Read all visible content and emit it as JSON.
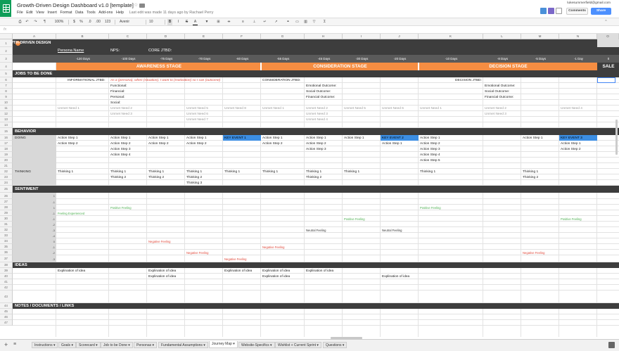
{
  "app": {
    "title": "Growth-Driven Design Dashboard v1.0 [template]",
    "last_edit": "Last edit was made 11 days ago by Rachael Perry",
    "email": "lukesummerfield@gmail.com",
    "comments_label": "Comments",
    "share_label": "Share"
  },
  "menu": [
    "File",
    "Edit",
    "View",
    "Insert",
    "Format",
    "Data",
    "Tools",
    "Add-ons",
    "Help"
  ],
  "toolbar": {
    "zoom": "100%",
    "currency": "$",
    "percent": "%",
    "decimals_less": ".0",
    "decimals_more": ".00",
    "format": "123",
    "font": "Avenir",
    "size": "10",
    "bold": "B",
    "italic": "I",
    "strike": "S",
    "text_color": "A"
  },
  "fx": "fx",
  "columns": [
    "A",
    "B",
    "C",
    "D",
    "E",
    "F",
    "G",
    "H",
    "I",
    "J",
    "K",
    "L",
    "M",
    "N",
    "O"
  ],
  "sheet": {
    "logo_text": "GROWTH-DRIVEN DESIGN",
    "persona_label": "Persona Name",
    "nps_label": "NPS:",
    "core_label": "CORE JTBD:",
    "days": [
      "-120 Days",
      "-100 Days",
      "-75 Days",
      "-70 Days",
      "-60 Days",
      "-55 Days",
      "-45 Days",
      "-30 Days",
      "-20 Days",
      "-10 Days",
      "-8 Days",
      "-5 Days",
      "-1 Day",
      "0"
    ],
    "stages": [
      "AWARENESS STAGE",
      "CONSIDERATION STAGE",
      "DECISION STAGE",
      "SALE"
    ],
    "sections": {
      "jobs": "JOBS TO BE DONE",
      "behavior": "BEHAVIOR",
      "sentiment": "SENTIMENT",
      "ideas": "IDEAS",
      "notes": "NOTES / DOCUMENTS / LINKS"
    },
    "info_label": "INFORMATIONAL JTBD:",
    "info_text": "As a (persona), when (situation), I want to (motivation) so I can (outcome)",
    "info_outcomes": [
      "Functional:",
      "Financial:",
      "Personal:",
      "Social:"
    ],
    "cons_label": "CONSIDERATION JTBD:",
    "cons_outcomes": [
      "Emotional Outcome:",
      "Social Outcome:",
      "Financial Outcome:"
    ],
    "dec_label": "DECISION JTBD:",
    "dec_outcomes": [
      "Emotional Outcome:",
      "Social Outcome:",
      "Financial Outcome:"
    ],
    "needs": [
      "Unmet Need 1",
      "Unmet Need 2",
      "Unmet Need 3",
      "Unmet Need 5",
      "Unmet Need 6",
      "Unmet Need 7",
      "Unmet Need 8",
      "Unmet Need 1",
      "Unmet Need 2",
      "Unmet Need 3",
      "Unmet Need 4",
      "Unmet Need 5",
      "Unmet Need 6",
      "Unmet Need 1",
      "Unmet Need 2",
      "Unmet Need 3",
      "Unmet Need 4"
    ],
    "doing_label": "DOING",
    "thinking_label": "THINKING",
    "action_steps": [
      "Action Step 1",
      "Action Step 2",
      "Action Step 3",
      "Action Step 4",
      "Action Step 5"
    ],
    "key_events": [
      "KEY EVENT 1",
      "KEY EVENT 2",
      "KEY EVENT 3"
    ],
    "thinking": [
      "Thinking 1",
      "Thinking 2",
      "Thinking 3"
    ],
    "scale": [
      "1",
      "-1",
      "1",
      "-1",
      "-1",
      "-2",
      "-3",
      "-4",
      "0",
      "-1",
      "-2",
      "-3",
      "-4",
      "-5"
    ],
    "feelings": {
      "positive": "Positive Feeling",
      "experienced": "Feeling Experienced",
      "neutral": "Neutral Feeling",
      "negative": "Negative Feeling"
    },
    "idea": "Explination of idea",
    "row_numbers": [
      "1",
      "2",
      "3",
      "4",
      "5",
      "6",
      "7",
      "8",
      "9",
      "10",
      "11",
      "12",
      "13",
      "14",
      "15",
      "16",
      "17",
      "18",
      "19",
      "20",
      "21",
      "22",
      "23",
      "24",
      "25",
      "26",
      "27",
      "28",
      "29",
      "30",
      "31",
      "32",
      "33",
      "34",
      "35",
      "36",
      "37",
      "38",
      "39",
      "40",
      "41",
      "42",
      "43",
      "44",
      "45",
      "46",
      "47",
      "48"
    ]
  },
  "tabs": [
    "Instructions",
    "Goals",
    "Scorecard",
    "Job to be Done",
    "Personas",
    "Fundamental Assumptions",
    "Journey Map",
    "Website-Specifics",
    "Wishlist + Current Sprint",
    "Questions"
  ],
  "active_tab": "Journey Map",
  "colors": {
    "orange": "#f58d42",
    "dark": "#3d3d3d",
    "blue": "#3c8ee3",
    "green_text": "#4caf50",
    "red_text": "#e0483a",
    "grey_row": "#d8d8d8"
  }
}
